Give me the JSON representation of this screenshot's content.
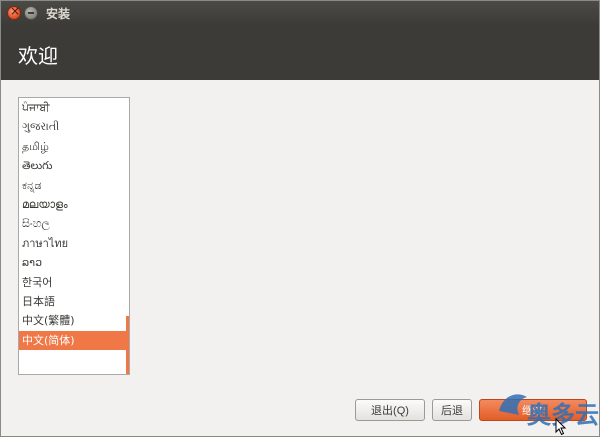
{
  "window": {
    "title": "安装"
  },
  "header": {
    "heading": "欢迎"
  },
  "language_list": {
    "items": [
      {
        "label": "ਪੰਜਾਬੀ",
        "selected": false
      },
      {
        "label": "ગુજરાતી",
        "selected": false
      },
      {
        "label": "தமிழ்",
        "selected": false
      },
      {
        "label": "తెలుగు",
        "selected": false
      },
      {
        "label": "ಕನ್ನಡ",
        "selected": false
      },
      {
        "label": "മലയാളം",
        "selected": false
      },
      {
        "label": "සිංහල",
        "selected": false
      },
      {
        "label": "ภาษาไทย",
        "selected": false
      },
      {
        "label": "ລາວ",
        "selected": false
      },
      {
        "label": "한국어",
        "selected": false
      },
      {
        "label": "日本語",
        "selected": false
      },
      {
        "label": "中文(繁體)",
        "selected": false
      },
      {
        "label": "中文(简体)",
        "selected": true
      }
    ]
  },
  "buttons": {
    "quit_label": "退出(Q)",
    "back_label": "后退",
    "continue_label": "继续"
  },
  "watermark": {
    "text": "奥多云"
  },
  "colors": {
    "accent": "#f07746",
    "header_bg": "#3c3b37",
    "window_bg": "#f2f1f0"
  }
}
